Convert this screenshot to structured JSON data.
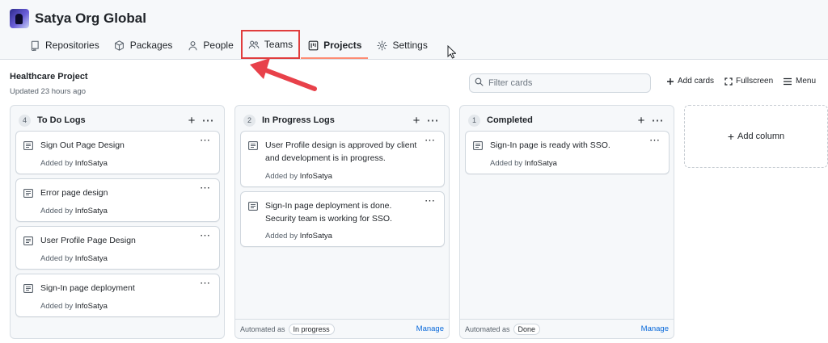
{
  "org": {
    "name": "Satya Org Global"
  },
  "nav": {
    "tabs": [
      {
        "label": "Repositories",
        "icon": "repo-icon"
      },
      {
        "label": "Packages",
        "icon": "package-icon"
      },
      {
        "label": "People",
        "icon": "person-icon"
      },
      {
        "label": "Teams",
        "icon": "people-icon",
        "highlighted": true
      },
      {
        "label": "Projects",
        "icon": "project-icon",
        "active": true
      },
      {
        "label": "Settings",
        "icon": "gear-icon"
      }
    ]
  },
  "project": {
    "title": "Healthcare Project",
    "updated": "Updated 23 hours ago",
    "filter_placeholder": "Filter cards",
    "add_cards": "Add cards",
    "fullscreen": "Fullscreen",
    "menu": "Menu"
  },
  "columns": [
    {
      "count": "4",
      "name": "To Do Logs",
      "cards": [
        {
          "title": "Sign Out Page Design",
          "added_by_prefix": "Added by",
          "added_by": "InfoSatya"
        },
        {
          "title": "Error page design",
          "added_by_prefix": "Added by",
          "added_by": "InfoSatya"
        },
        {
          "title": "User Profile Page Design",
          "added_by_prefix": "Added by",
          "added_by": "InfoSatya"
        },
        {
          "title": "Sign-In page deployment",
          "added_by_prefix": "Added by",
          "added_by": "InfoSatya"
        }
      ]
    },
    {
      "count": "2",
      "name": "In Progress Logs",
      "cards": [
        {
          "title": "User Profile design is approved by client and development is in progress.",
          "added_by_prefix": "Added by",
          "added_by": "InfoSatya"
        },
        {
          "title": "Sign-In page deployment is done. Security team is working for SSO.",
          "added_by_prefix": "Added by",
          "added_by": "InfoSatya"
        }
      ],
      "automation": {
        "label": "Automated as",
        "value": "In progress",
        "manage": "Manage"
      }
    },
    {
      "count": "1",
      "name": "Completed",
      "cards": [
        {
          "title": "Sign-In page is ready with SSO.",
          "added_by_prefix": "Added by",
          "added_by": "InfoSatya"
        }
      ],
      "automation": {
        "label": "Automated as",
        "value": "Done",
        "manage": "Manage"
      }
    }
  ],
  "add_column": "Add column",
  "colors": {
    "highlight_box": "#e03d3d",
    "arrow": "#e8414a",
    "active_tab_underline": "#fd8c73",
    "link": "#0969da"
  }
}
